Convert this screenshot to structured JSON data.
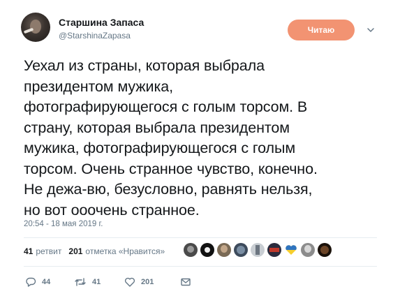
{
  "author": {
    "name": "Старшина Запаса",
    "handle": "@StarshinaZapasa",
    "avatar_icon": "avatar-smoking-man"
  },
  "follow_button": {
    "label": "Читаю",
    "color": "#f29372"
  },
  "tweet": {
    "text": "Уехал из страны, которая выбрала\nпрезидентом мужика,\nфотографирующегося с голым торсом. В\nстрану, которая выбрала президентом\nмужика, фотографирующегося с голым\nторсом. Очень странное чувство, конечно.\nНе дежа-вю, безусловно, равнять нельзя,\nно вот ооочень странное.",
    "timestamp": "20:54 - 18 мая 2019 г."
  },
  "stats": {
    "retweets_count": "41",
    "retweets_label": "ретвит",
    "likes_count": "201",
    "likes_label": "отметка «Нравится»"
  },
  "likers": [
    {
      "icon": "avatar-liker-1",
      "color": "#4a4a4a"
    },
    {
      "icon": "avatar-liker-2",
      "color": "#111111"
    },
    {
      "icon": "avatar-liker-3",
      "color": "#7a6a55"
    },
    {
      "icon": "avatar-liker-4",
      "color": "#3d4b5c"
    },
    {
      "icon": "avatar-liker-5",
      "color": "#c9ced3"
    },
    {
      "icon": "avatar-liker-6",
      "color": "#2b2b3d"
    },
    {
      "icon": "avatar-liker-7-heart",
      "color": "#f7cf2e"
    },
    {
      "icon": "avatar-liker-8",
      "color": "#8c8c8c"
    },
    {
      "icon": "avatar-liker-9",
      "color": "#3a2516"
    }
  ],
  "actions": {
    "reply_count": "44",
    "retweet_count": "41",
    "like_count": "201"
  }
}
